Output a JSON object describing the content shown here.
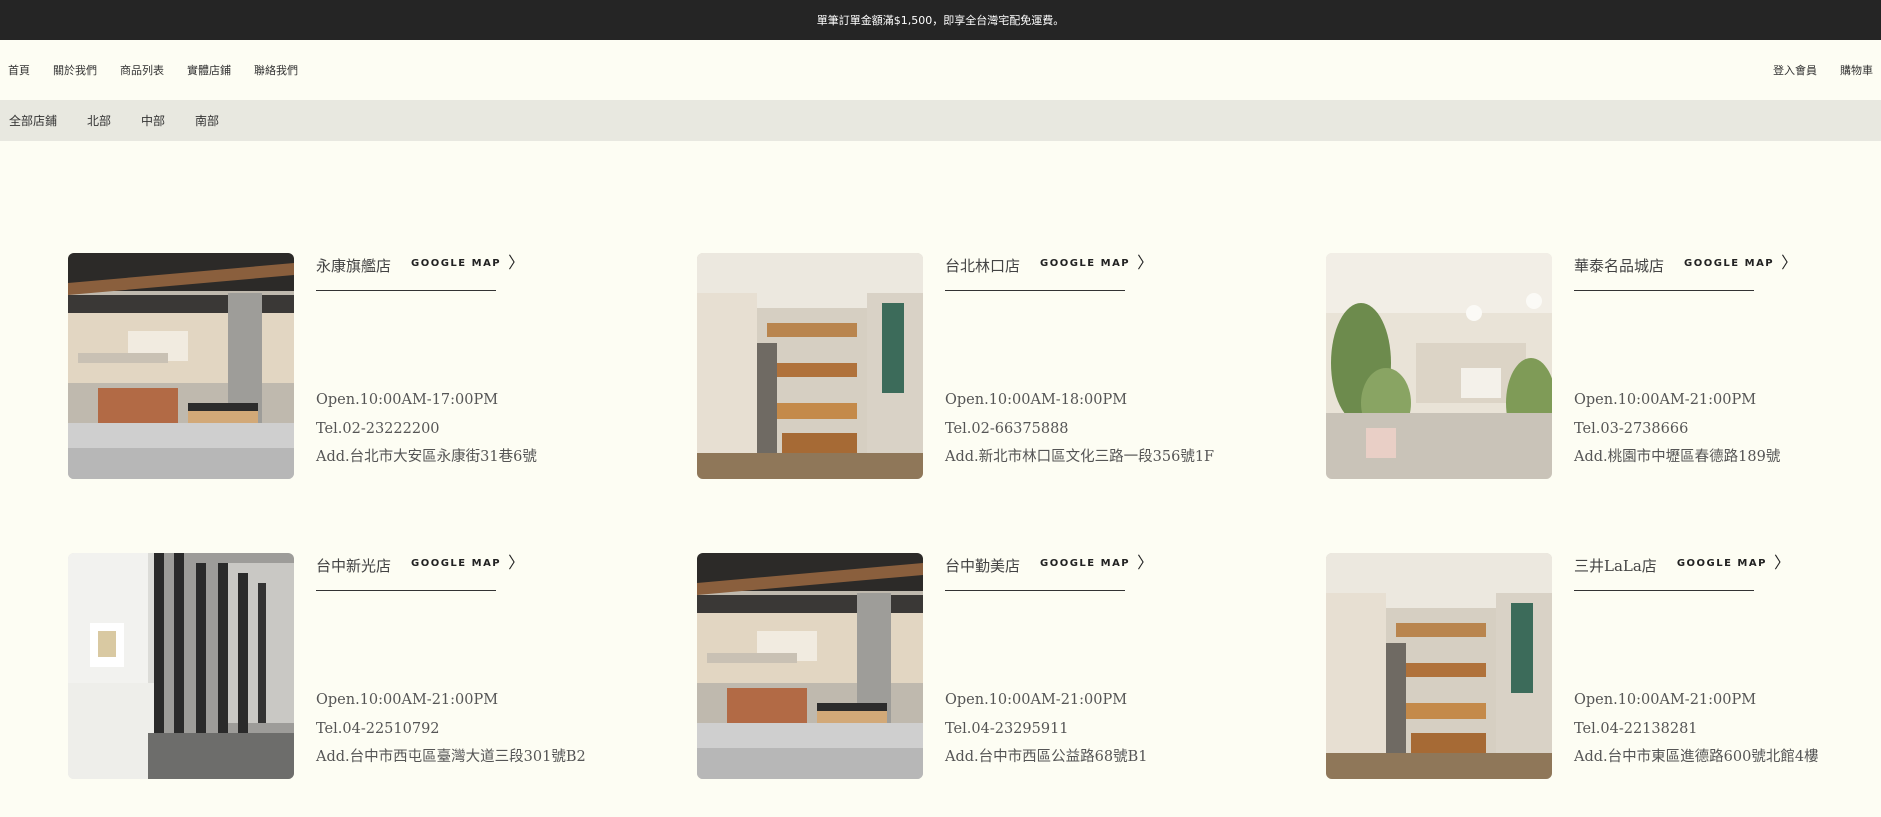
{
  "announcement": "單筆訂單金額滿$1,500，即享全台灣宅配免運費。",
  "nav": {
    "left": [
      "首頁",
      "關於我們",
      "商品列表",
      "實體店鋪",
      "聯絡我們"
    ],
    "right": [
      "登入會員",
      "購物車"
    ]
  },
  "regions": [
    "全部店鋪",
    "北部",
    "中部",
    "南部"
  ],
  "map_label": "GOOGLE MAP",
  "stores": [
    {
      "name": "永康旗艦店",
      "open": "Open.10:00AM-17:00PM",
      "tel": "Tel.02-23222200",
      "address": "Add.台北市大安區永康街31巷6號",
      "photo": "shop-interior-counter"
    },
    {
      "name": "台北林口店",
      "open": "Open.10:00AM-18:00PM",
      "tel": "Tel.02-66375888",
      "address": "Add.新北市林口區文化三路一段356號1F",
      "photo": "mall-atrium"
    },
    {
      "name": "華泰名品城店",
      "open": "Open.10:00AM-21:00PM",
      "tel": "Tel.03-2738666",
      "address": "Add.桃園市中壢區春德路189號",
      "photo": "shop-interior-plants"
    },
    {
      "name": "台中新光店",
      "open": "Open.10:00AM-21:00PM",
      "tel": "Tel.04-22510792",
      "address": "Add.台中市西屯區臺灣大道三段301號B2",
      "photo": "shop-interior-beads"
    },
    {
      "name": "台中勤美店",
      "open": "Open.10:00AM-21:00PM",
      "tel": "Tel.04-23295911",
      "address": "Add.台中市西區公益路68號B1",
      "photo": "shop-interior-counter"
    },
    {
      "name": "三井LaLa店",
      "open": "Open.10:00AM-21:00PM",
      "tel": "Tel.04-22138281",
      "address": "Add.台中市東區進德路600號北館4樓",
      "photo": "mall-atrium"
    }
  ],
  "colors": {
    "page_bg": "#fdfdf3",
    "announce_bg": "#252525",
    "subnav_bg": "#e8e8e0",
    "text": "#333333"
  }
}
